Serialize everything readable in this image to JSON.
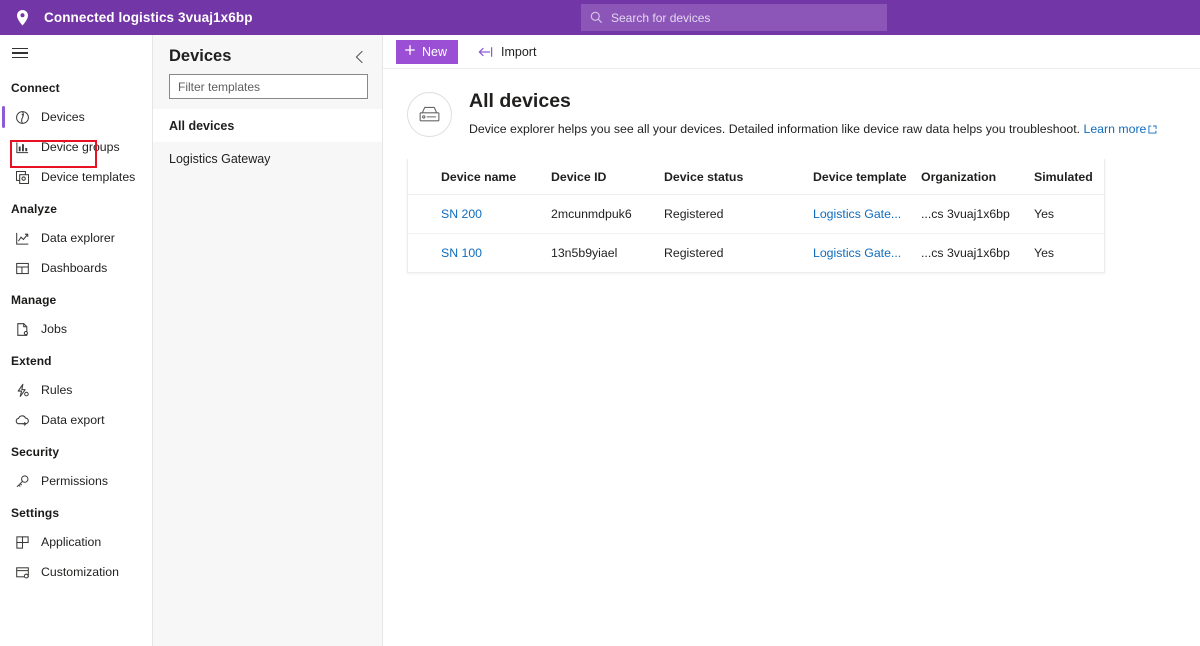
{
  "topbar": {
    "app_title": "Connected logistics 3vuaj1x6bp",
    "logo_icon": "location-pin-icon",
    "search": {
      "placeholder": "Search for devices",
      "value": "",
      "icon": "search-icon"
    },
    "background_color": "#7236a6",
    "search_background_color": "#8c56b8"
  },
  "sidebar": {
    "menu_icon": "hamburger-menu-icon",
    "sections": [
      {
        "label": "Connect",
        "items": [
          {
            "label": "Devices",
            "icon": "devices-icon",
            "selected": true,
            "highlighted": true
          },
          {
            "label": "Device groups",
            "icon": "device-groups-icon",
            "selected": false,
            "highlighted": false
          },
          {
            "label": "Device templates",
            "icon": "device-templates-icon",
            "selected": false,
            "highlighted": false
          }
        ]
      },
      {
        "label": "Analyze",
        "items": [
          {
            "label": "Data explorer",
            "icon": "line-chart-icon",
            "selected": false,
            "highlighted": false
          },
          {
            "label": "Dashboards",
            "icon": "dashboard-grid-icon",
            "selected": false,
            "highlighted": false
          }
        ]
      },
      {
        "label": "Manage",
        "items": [
          {
            "label": "Jobs",
            "icon": "jobs-document-icon",
            "selected": false,
            "highlighted": false
          }
        ]
      },
      {
        "label": "Extend",
        "items": [
          {
            "label": "Rules",
            "icon": "rules-lightning-icon",
            "selected": false,
            "highlighted": false
          },
          {
            "label": "Data export",
            "icon": "cloud-export-icon",
            "selected": false,
            "highlighted": false
          }
        ]
      },
      {
        "label": "Security",
        "items": [
          {
            "label": "Permissions",
            "icon": "key-icon",
            "selected": false,
            "highlighted": false
          }
        ]
      },
      {
        "label": "Settings",
        "items": [
          {
            "label": "Application",
            "icon": "application-layout-icon",
            "selected": false,
            "highlighted": false
          },
          {
            "label": "Customization",
            "icon": "customization-icon",
            "selected": false,
            "highlighted": false
          }
        ]
      }
    ],
    "selection_accent_color": "#8b5cd6",
    "annotation_color": "#e81123"
  },
  "devices_panel": {
    "title": "Devices",
    "collapse_icon": "chevron-left-icon",
    "filter": {
      "placeholder": "Filter templates",
      "value": ""
    },
    "templates": [
      {
        "label": "All devices",
        "active": true
      },
      {
        "label": "Logistics Gateway",
        "active": false
      }
    ]
  },
  "command_bar": {
    "new_label": "New",
    "new_icon": "plus-icon",
    "new_color": "#9a4fd4",
    "import_label": "Import",
    "import_icon": "import-arrow-icon"
  },
  "page_header": {
    "avatar_icon": "gateway-device-icon",
    "title": "All devices",
    "description": "Device explorer helps you see all your devices. Detailed information like device raw data helps you troubleshoot.",
    "learn_more_label": "Learn more",
    "learn_more_icon": "external-link-icon",
    "link_color": "#0f6cbd"
  },
  "table": {
    "columns": [
      "Device name",
      "Device ID",
      "Device status",
      "Device template",
      "Organization",
      "Simulated"
    ],
    "rows": [
      {
        "device_name": "SN 200",
        "device_id": "2mcunmdpuk6",
        "device_status": "Registered",
        "device_template": "Logistics Gate...",
        "organization": "...cs 3vuaj1x6bp",
        "simulated": "Yes"
      },
      {
        "device_name": "SN 100",
        "device_id": "13n5b9yiael",
        "device_status": "Registered",
        "device_template": "Logistics Gate...",
        "organization": "...cs 3vuaj1x6bp",
        "simulated": "Yes"
      }
    ]
  }
}
